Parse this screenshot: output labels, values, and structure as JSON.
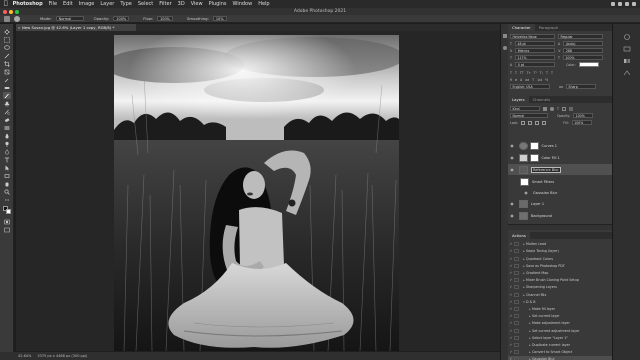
{
  "menubar": {
    "app": "Photoshop",
    "items": [
      "File",
      "Edit",
      "Image",
      "Layer",
      "Type",
      "Select",
      "Filter",
      "3D",
      "View",
      "Plugins",
      "Window",
      "Help"
    ]
  },
  "window": {
    "title": "Adobe Photoshop 2021"
  },
  "options": {
    "mode_label": "Mode:",
    "mode_value": "Normal",
    "opacity_label": "Opacity:",
    "opacity_value": "100%",
    "flow_label": "Flow:",
    "flow_value": "100%",
    "smoothing_label": "Smoothing:",
    "smoothing_value": "10%"
  },
  "document": {
    "tab_title": "New Susan.jpg @ 42.6% (Layer 1 copy, RGB/8) *"
  },
  "status": {
    "zoom": "42.64%",
    "size": "3375 px x 4468 px (300 ppi)"
  },
  "character": {
    "tabs": [
      "Character",
      "Paragraph"
    ],
    "font_family": "Helvetica Neue",
    "font_style": "Regular",
    "font_size": "48 pt",
    "leading": "(Auto)",
    "kerning": "Metrics",
    "tracking": "288",
    "vscale": "117%",
    "hscale": "100%",
    "baseline": "0 pt",
    "color_label": "Color:",
    "language": "English: USA",
    "aa_label": "aa",
    "aa_value": "Sharp"
  },
  "layers": {
    "tabs": [
      "Layers",
      "Channels"
    ],
    "kind_label": "Kind",
    "blend": "Normal",
    "opacity_label": "Opacity:",
    "opacity_value": "100%",
    "lock_label": "Lock:",
    "fill_label": "Fill:",
    "fill_value": "100%",
    "items": [
      {
        "name": "Curves 1",
        "kind": "adjustment"
      },
      {
        "name": "Color Fill 1",
        "kind": "fill"
      },
      {
        "name": "Reference Blur",
        "kind": "photo",
        "selected": true
      },
      {
        "name": "Smart Filters",
        "kind": "filter"
      },
      {
        "name": "Gaussian Blur",
        "kind": "subfilter"
      },
      {
        "name": "Layer 1",
        "kind": "photo"
      },
      {
        "name": "Background",
        "kind": "photo"
      }
    ]
  },
  "actions": {
    "tabs": [
      "Actions"
    ],
    "items": [
      {
        "name": "Molten Lead",
        "indent": 1
      },
      {
        "name": "Sepia Toning (layer)",
        "indent": 1
      },
      {
        "name": "Quadrant Colors",
        "indent": 1
      },
      {
        "name": "Save as Photoshop PDF",
        "indent": 1
      },
      {
        "name": "Gradient Map",
        "indent": 1
      },
      {
        "name": "Mixer Brush Cloning Paint Setup",
        "indent": 1
      },
      {
        "name": "Sharpening Layers",
        "indent": 1
      },
      {
        "name": "Channel Mix",
        "indent": 1
      },
      {
        "name": "D & B",
        "indent": 1,
        "open": true
      },
      {
        "name": "Make fill layer",
        "indent": 2
      },
      {
        "name": "Set current layer",
        "indent": 2
      },
      {
        "name": "Make adjustment layer",
        "indent": 2
      },
      {
        "name": "Set current adjustment layer",
        "indent": 2
      },
      {
        "name": "Select layer \"Layer 1\"",
        "indent": 2
      },
      {
        "name": "Duplicate current layer",
        "indent": 2
      },
      {
        "name": "Convert to Smart Object",
        "indent": 2
      },
      {
        "name": "Gaussian Blur",
        "indent": 2,
        "selected": true
      }
    ]
  }
}
